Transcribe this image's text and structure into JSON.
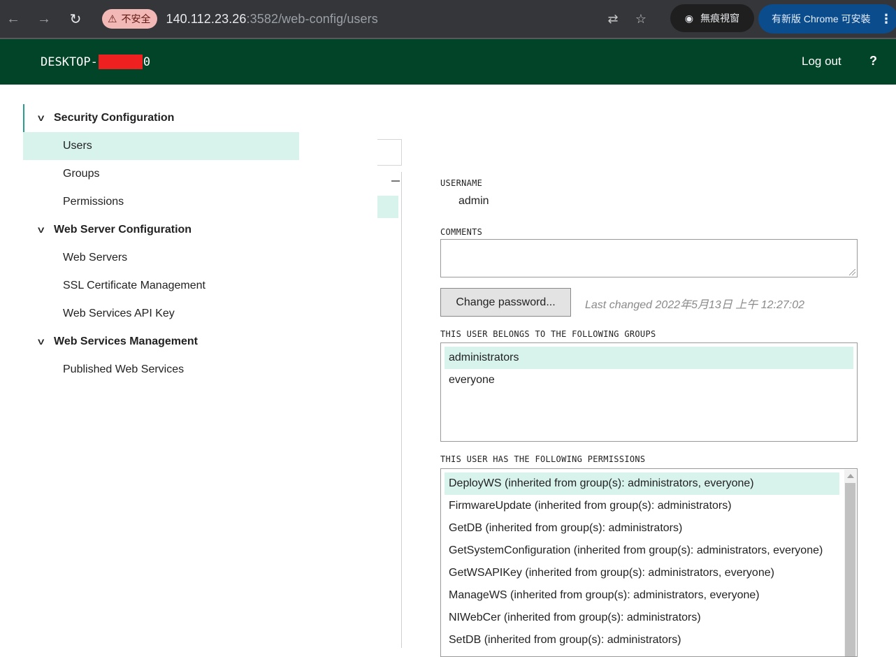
{
  "browser": {
    "insecure_label": "不安全",
    "url_host": "140.112.23.26",
    "url_rest": ":3582/web-config/users",
    "incognito_label": "無痕視窗",
    "update_label": "有新版 Chrome 可安裝"
  },
  "header": {
    "host_prefix": "DESKTOP-",
    "host_suffix": "0",
    "logout_label": "Log out",
    "help_label": "?"
  },
  "sidebar": {
    "sections": [
      {
        "title": "Security Configuration",
        "items": [
          "Users",
          "Groups",
          "Permissions"
        ]
      },
      {
        "title": "Web Server Configuration",
        "items": [
          "Web Servers",
          "SSL Certificate Management",
          "Web Services API Key"
        ]
      },
      {
        "title": "Web Services Management",
        "items": [
          "Published Web Services"
        ]
      }
    ],
    "selected": "Users"
  },
  "detail": {
    "username_label": "USERNAME",
    "username_value": "admin",
    "comments_label": "COMMENTS",
    "comments_value": "",
    "change_password_label": "Change password...",
    "last_changed": "Last changed 2022年5月13日 上午 12:27:02",
    "groups_label": "THIS USER BELONGS TO THE FOLLOWING GROUPS",
    "groups": [
      "administrators",
      "everyone"
    ],
    "permissions_label": "THIS USER HAS THE FOLLOWING PERMISSIONS",
    "permissions": [
      "DeployWS (inherited from group(s): administrators, everyone)",
      "FirmwareUpdate (inherited from group(s): administrators)",
      "GetDB (inherited from group(s): administrators)",
      "GetSystemConfiguration (inherited from group(s): administrators, everyone)",
      "GetWSAPIKey (inherited from group(s): administrators, everyone)",
      "ManageWS (inherited from group(s): administrators, everyone)",
      "NIWebCer (inherited from group(s): administrators)",
      "SetDB (inherited from group(s): administrators)"
    ]
  },
  "colors": {
    "header_bg": "#024427",
    "selection_bg": "#d7f3ec",
    "accent": "#2a9d8f"
  }
}
